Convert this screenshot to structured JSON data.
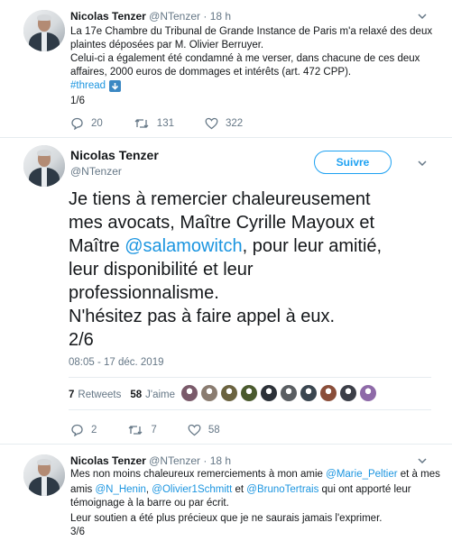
{
  "tweet1": {
    "name": "Nicolas Tenzer",
    "handle": "@NTenzer",
    "time": "· 18 h",
    "line1": "La 17e Chambre du Tribunal de Grande Instance de Paris m'a relaxé des deux",
    "line2": "plaintes déposées par M. Olivier Berruyer.",
    "line3": "Celui-ci a également été condamné à me verser, dans chacune de ces deux",
    "line4": "affaires, 2000 euros de dommages et intérêts (art. 472 CPP).",
    "hashtag": "#thread",
    "count": "1/6",
    "replies": "20",
    "retweets": "131",
    "likes": "322"
  },
  "tweet2": {
    "name": "Nicolas Tenzer",
    "handle": "@NTenzer",
    "follow_label": "Suivre",
    "line1": "Je tiens à remercier chaleureusement",
    "line2": "mes avocats, Maître Cyrille Mayoux et",
    "line3_pre": "Maître ",
    "line3_mention": "@salamowitch",
    "line3_post": ", pour leur amitié,",
    "line4": "leur disponibilité et leur",
    "line5": "professionnalisme.",
    "line6": "N'hésitez pas à faire appel à eux.",
    "line7": "2/6",
    "timestamp": "08:05 - 17 déc. 2019",
    "retweets_count": "7",
    "retweets_label": "Retweets",
    "likes_count": "58",
    "likes_label": "J'aime",
    "replies": "2",
    "retweets": "7",
    "likes": "58",
    "liker_colors": [
      "#7a5a6a",
      "#8a7c70",
      "#6b6340",
      "#4a5a2e",
      "#2c3138",
      "#5a5e62",
      "#3a4650",
      "#8a4e3a",
      "#3c3f48",
      "#8e6aa8"
    ]
  },
  "tweet3": {
    "name": "Nicolas Tenzer",
    "handle": "@NTenzer",
    "time": "· 18 h",
    "l1_pre": "Mes non moins chaleureux remerciements à mon amie ",
    "l1_mention": "@Marie_Peltier",
    "l1_post": " et à mes",
    "l2_pre": "amis ",
    "l2_m1": "@N_Henin",
    "l2_sep1": ", ",
    "l2_m2": "@Olivier1Schmitt",
    "l2_sep2": " et ",
    "l2_m3": "@BrunoTertrais",
    "l2_post": " qui ont apporté leur",
    "line3": "témoignage à la barre ou par écrit.",
    "line4": "Leur soutien a été plus précieux que je ne saurais jamais l'exprimer.",
    "count": "3/6"
  },
  "colors": {
    "link": "#1b95e0",
    "muted": "#657786",
    "border": "#e6ecf0"
  },
  "icons": [
    "reply-icon",
    "retweet-icon",
    "like-icon",
    "chevron-down-icon",
    "down-arrow-emoji-icon"
  ]
}
